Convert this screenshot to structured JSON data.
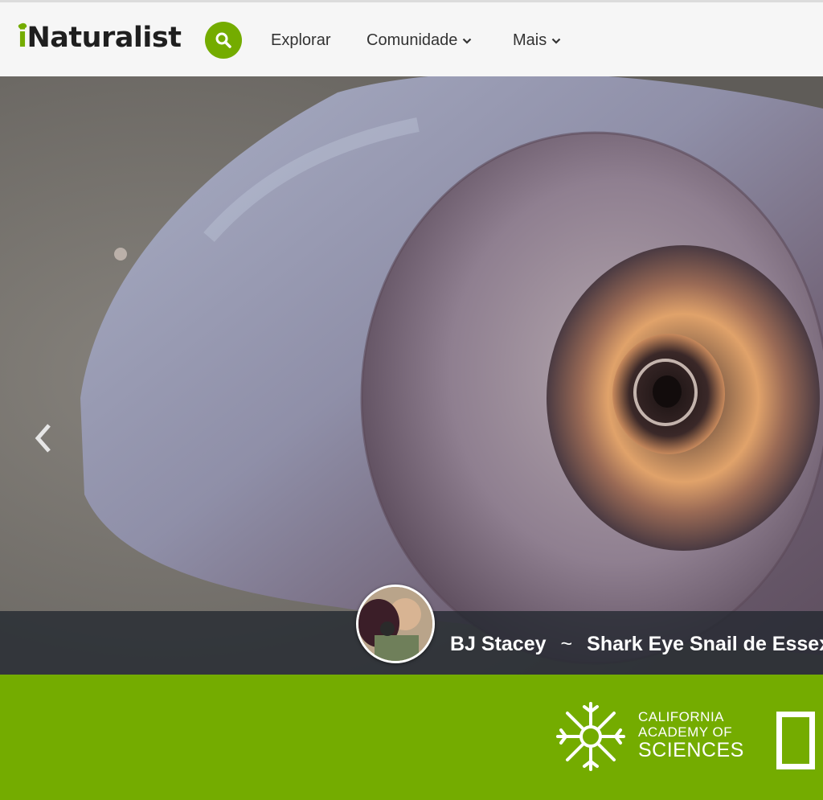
{
  "header": {
    "logo": {
      "first_letter": "i",
      "rest": "Naturalist"
    },
    "search_icon": "search-icon",
    "nav": {
      "explore_label": "Explorar",
      "community_label": "Comunidade",
      "more_label": "Mais"
    },
    "colors": {
      "brand": "#74ac00",
      "background": "#f6f6f6"
    }
  },
  "hero": {
    "photographer": "BJ Stacey",
    "separator": "~",
    "photo_title": "Shark Eye Snail de Essex",
    "prev_icon": "chevron-left-icon"
  },
  "partners": {
    "cas": {
      "line1": "CALIFORNIA",
      "line2": "ACADEMY OF",
      "line3": "SCIENCES"
    },
    "national_geographic": "national-geographic-logo"
  }
}
